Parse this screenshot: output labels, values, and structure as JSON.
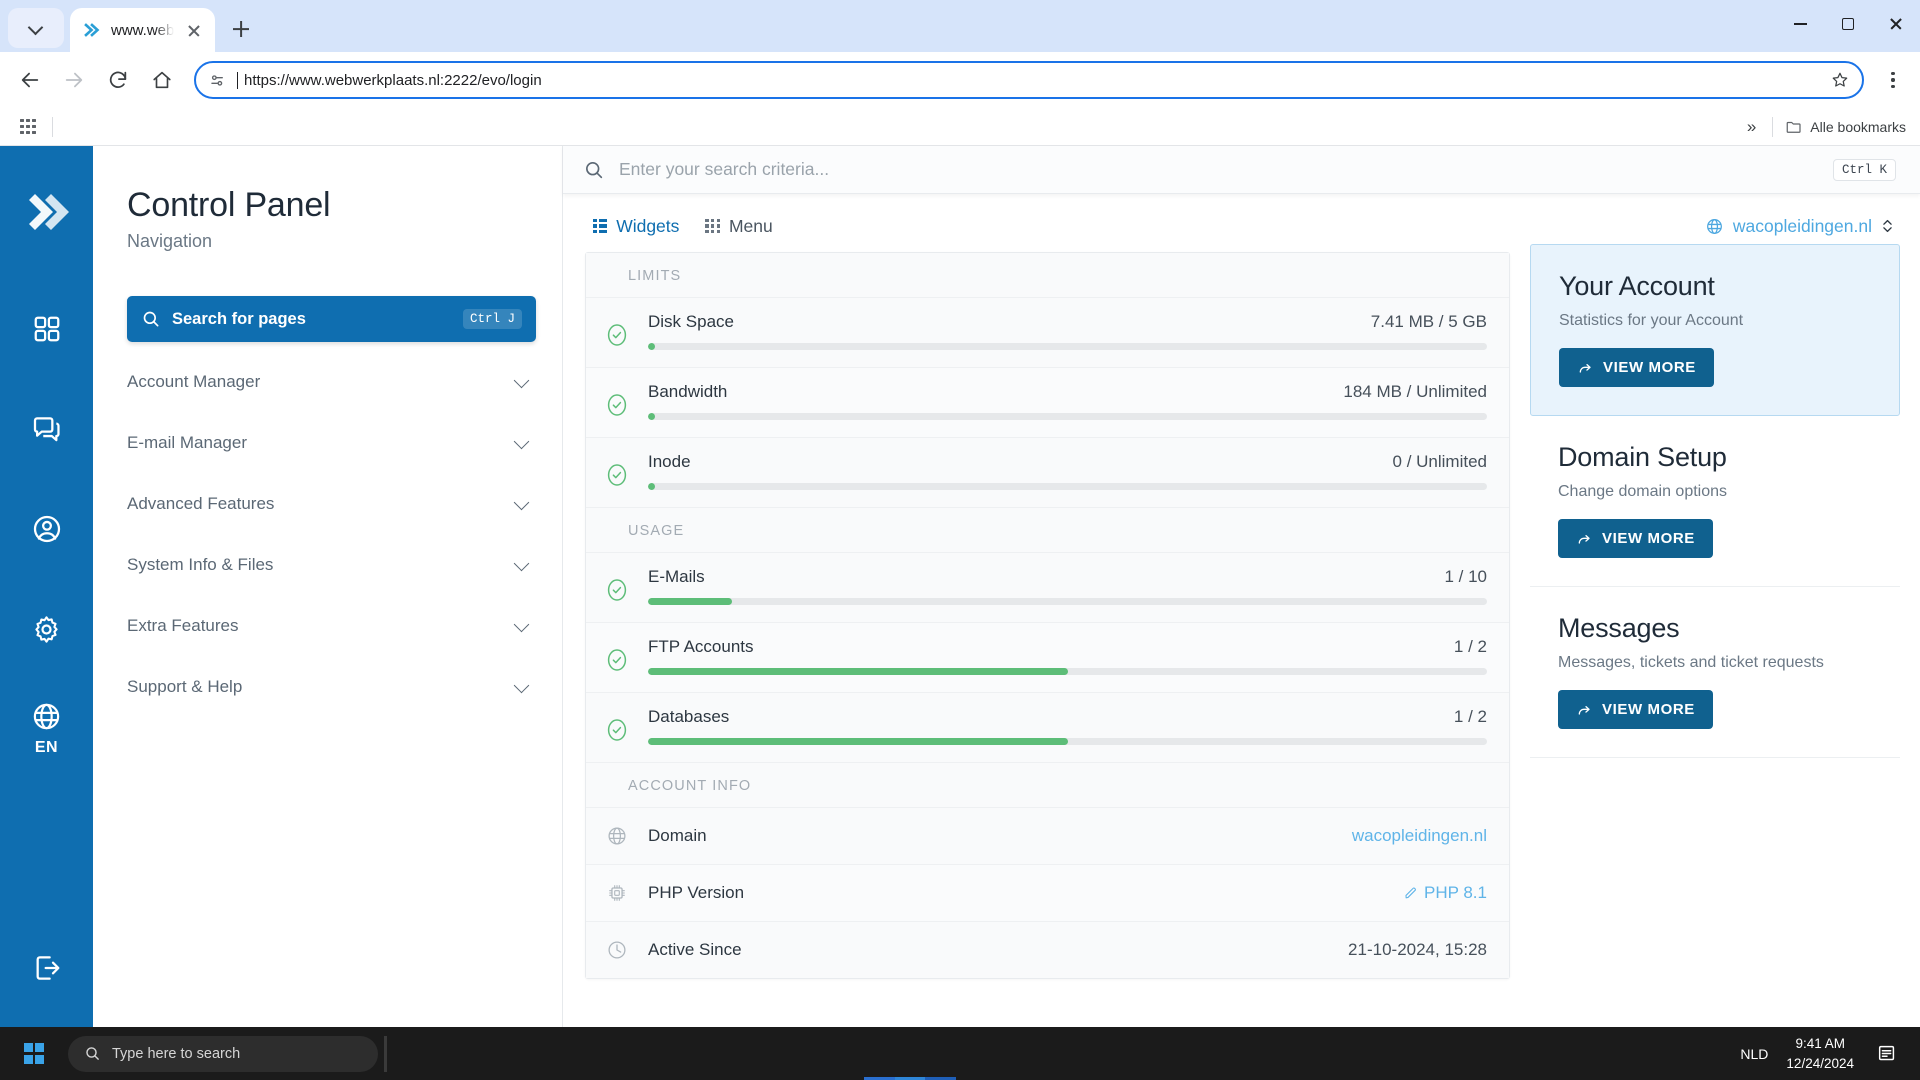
{
  "browser": {
    "tab": {
      "title": "www.webw",
      "favicon": "webwerkplaats-logo-icon"
    },
    "url": "https://www.webwerkplaats.nl:2222/evo/login",
    "bookmarks_label": "Alle bookmarks",
    "overflow_label": "»"
  },
  "rail": {
    "logo": "chevrons-right-logo",
    "items": [
      {
        "name": "dashboard-icon"
      },
      {
        "name": "chat-icon"
      },
      {
        "name": "account-icon"
      },
      {
        "name": "settings-icon"
      },
      {
        "name": "language-globe-icon"
      }
    ],
    "language": "EN",
    "logout": "logout-icon"
  },
  "nav": {
    "title": "Control Panel",
    "subtitle": "Navigation",
    "search": {
      "label": "Search for pages",
      "shortcut": "Ctrl J"
    },
    "items": [
      {
        "label": "Account Manager"
      },
      {
        "label": "E-mail Manager"
      },
      {
        "label": "Advanced Features"
      },
      {
        "label": "System Info & Files"
      },
      {
        "label": "Extra Features"
      },
      {
        "label": "Support & Help"
      }
    ]
  },
  "main": {
    "search": {
      "placeholder": "Enter your search criteria...",
      "shortcut": "Ctrl K"
    },
    "tabs": [
      {
        "label": "Widgets",
        "icon": "widgets-icon",
        "active": true
      },
      {
        "label": "Menu",
        "icon": "menu-grid-icon",
        "active": false
      }
    ],
    "limits": {
      "heading": "LIMITS",
      "rows": [
        {
          "name": "Disk Space",
          "value": "7.41 MB / 5 GB",
          "percent": 0.3,
          "status": "ok"
        },
        {
          "name": "Bandwidth",
          "value": "184 MB / Unlimited",
          "percent": 0.3,
          "status": "ok"
        },
        {
          "name": "Inode",
          "value": "0 / Unlimited",
          "percent": 0.3,
          "status": "ok"
        }
      ]
    },
    "usage": {
      "heading": "USAGE",
      "rows": [
        {
          "name": "E-Mails",
          "value": "1 / 10",
          "percent": 10,
          "status": "ok"
        },
        {
          "name": "FTP Accounts",
          "value": "1 / 2",
          "percent": 50,
          "status": "ok"
        },
        {
          "name": "Databases",
          "value": "1 / 2",
          "percent": 50,
          "status": "ok"
        }
      ]
    },
    "account_info": {
      "heading": "ACCOUNT INFO",
      "rows": [
        {
          "icon": "globe-icon",
          "name": "Domain",
          "value": "wacopleidingen.nl",
          "link": true,
          "editable": false
        },
        {
          "icon": "chip-icon",
          "name": "PHP Version",
          "value": "PHP 8.1",
          "link": true,
          "editable": true
        },
        {
          "icon": "clock-icon",
          "name": "Active Since",
          "value": "21-10-2024, 15:28",
          "link": false,
          "editable": false
        }
      ]
    }
  },
  "aside": {
    "domain_selector": {
      "name": "wacopleidingen.nl",
      "icon": "globe-icon"
    },
    "cards": [
      {
        "title": "Your Account",
        "subtitle": "Statistics for your Account",
        "button": "VIEW MORE",
        "active": true
      },
      {
        "title": "Domain Setup",
        "subtitle": "Change domain options",
        "button": "VIEW MORE",
        "active": false
      },
      {
        "title": "Messages",
        "subtitle": "Messages, tickets and ticket requests",
        "button": "VIEW MORE",
        "active": false
      }
    ]
  },
  "taskbar": {
    "search_placeholder": "Type here to search",
    "language": "NLD",
    "time": "9:41 AM",
    "date": "12/24/2024"
  },
  "colors": {
    "brand_blue": "#0f6eb0",
    "accent_link": "#4ea8e0",
    "success_green": "#5dbd78",
    "chrome_blue": "#1a73e8"
  }
}
